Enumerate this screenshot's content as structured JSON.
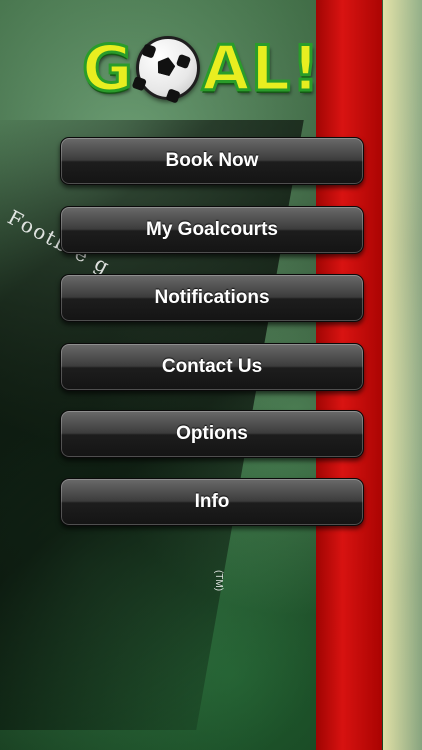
{
  "app": {
    "logo_left": "G",
    "logo_right": "AL!",
    "ball_icon": "soccer-ball-icon"
  },
  "background": {
    "side_text": "Footb    e   g",
    "tm_text": "(TM)"
  },
  "menu": {
    "items": [
      {
        "label": "Book Now"
      },
      {
        "label": "My Goalcourts"
      },
      {
        "label": "Notifications"
      },
      {
        "label": "Contact Us"
      },
      {
        "label": "Options"
      },
      {
        "label": "Info"
      }
    ]
  },
  "colors": {
    "logo_fill": "#e8ee20",
    "logo_outline": "#2a9c2a",
    "stripe_red": "#e10f0f"
  }
}
